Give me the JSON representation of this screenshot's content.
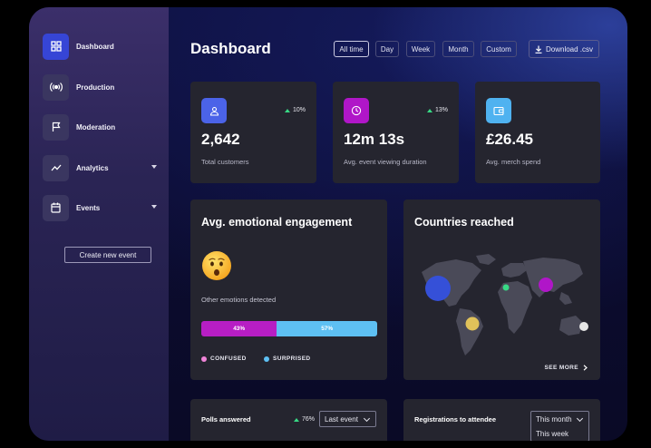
{
  "sidebar": {
    "items": [
      {
        "label": "Dashboard",
        "icon": "grid-icon",
        "active": true
      },
      {
        "label": "Production",
        "icon": "broadcast-icon"
      },
      {
        "label": "Moderation",
        "icon": "flag-icon"
      },
      {
        "label": "Analytics",
        "icon": "trend-line-icon",
        "has_dropdown": true
      },
      {
        "label": "Events",
        "icon": "calendar-icon",
        "has_dropdown": true
      }
    ],
    "create_button": "Create new event"
  },
  "header": {
    "title": "Dashboard",
    "filters": [
      "All time",
      "Day",
      "Week",
      "Month",
      "Custom"
    ],
    "active_filter": "All time",
    "download_label": "Download .csv"
  },
  "stats": [
    {
      "value": "2,642",
      "label": "Total customers",
      "trend": "10%",
      "icon": "user-icon",
      "color": "#4b63e8"
    },
    {
      "value": "12m 13s",
      "label": "Avg. event viewing duration",
      "trend": "13%",
      "icon": "clock-icon",
      "color": "#b016c8"
    },
    {
      "value": "£26.45",
      "label": "Avg. merch spend",
      "trend": "",
      "icon": "wallet-icon",
      "color": "#4fb2f0"
    }
  ],
  "engagement": {
    "title": "Avg. emotional engagement",
    "emoji": "hushed-face-icon",
    "subtitle": "Other emotions detected",
    "segments": [
      {
        "name": "CONFUSED",
        "value": 43,
        "label": "43%",
        "color": "#b71ec4"
      },
      {
        "name": "SURPRISED",
        "value": 57,
        "label": "57%",
        "color": "#5ec0f3"
      }
    ]
  },
  "countries": {
    "title": "Countries reached",
    "see_more": "SEE MORE",
    "markers": [
      {
        "region": "North America",
        "color": "#3550d8"
      },
      {
        "region": "South America",
        "color": "#e0c25a"
      },
      {
        "region": "Africa",
        "color": "#38d985"
      },
      {
        "region": "South Asia",
        "color": "#b016c8"
      },
      {
        "region": "Australia",
        "color": "#e6e6e6"
      }
    ]
  },
  "polls": {
    "title": "Polls answered",
    "trend": "76%",
    "select": "Last event"
  },
  "registrations": {
    "title": "Registrations to attendee",
    "select": "This month",
    "option_below": "This week"
  }
}
